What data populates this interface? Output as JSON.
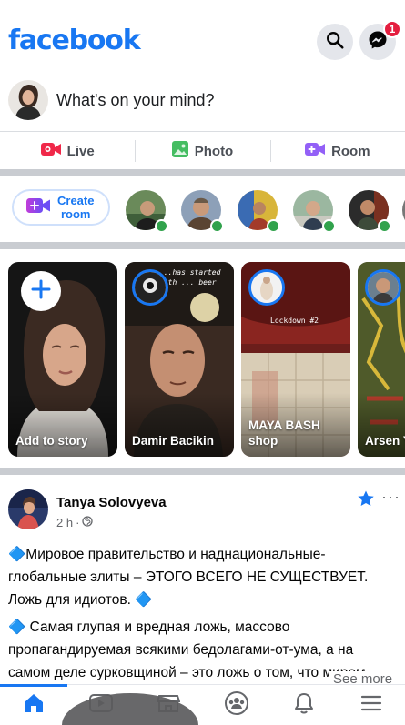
{
  "app": {
    "logo_text": "facebook",
    "brand_color": "#1877f2",
    "header_buttons": [
      {
        "icon": "search-icon"
      },
      {
        "icon": "messenger-icon",
        "badge": "1"
      }
    ]
  },
  "composer": {
    "placeholder": "What's on your mind?"
  },
  "actions": [
    {
      "label": "Live",
      "icon": "live-video-icon",
      "color": "#f02849"
    },
    {
      "label": "Photo",
      "icon": "photo-icon",
      "color": "#45bd62"
    },
    {
      "label": "Room",
      "icon": "room-icon",
      "color": "#9360f7"
    }
  ],
  "rooms": {
    "create_label_line1": "Create",
    "create_label_line2": "room",
    "online_color": "#31a24c"
  },
  "stories": [
    {
      "name": "Add to story",
      "type": "create"
    },
    {
      "name": "Damir Bacikin",
      "overlay_text": "...has started with ... beer"
    },
    {
      "name": "MAYA BASH shop",
      "overlay_text": "Lockdown #2"
    },
    {
      "name": "Arsen Y"
    }
  ],
  "post": {
    "author": "Tanya Solovyeva",
    "time": "2 h",
    "paragraphs": [
      "🔷Мировое правительство и наднациональные-глобальные элиты – ЭТОГО ВСЕГО НЕ СУЩЕСТВУЕТ. Ложь для идиотов. 🔷",
      "🔷 Самая глупая и вредная ложь, массово пропагандируемая всякими бедолагами-от-ума, а на самом деле сурковщиной – это ложь о том, что миром управляют какие-то элиты, не прив"
    ],
    "see_more": "See more"
  },
  "nav": [
    {
      "icon": "home-icon",
      "active": true
    },
    {
      "icon": "watch-icon",
      "active": false
    },
    {
      "icon": "marketplace-icon",
      "active": false
    },
    {
      "icon": "groups-icon",
      "active": false
    },
    {
      "icon": "notifications-icon",
      "active": false
    },
    {
      "icon": "menu-icon",
      "active": false
    }
  ]
}
